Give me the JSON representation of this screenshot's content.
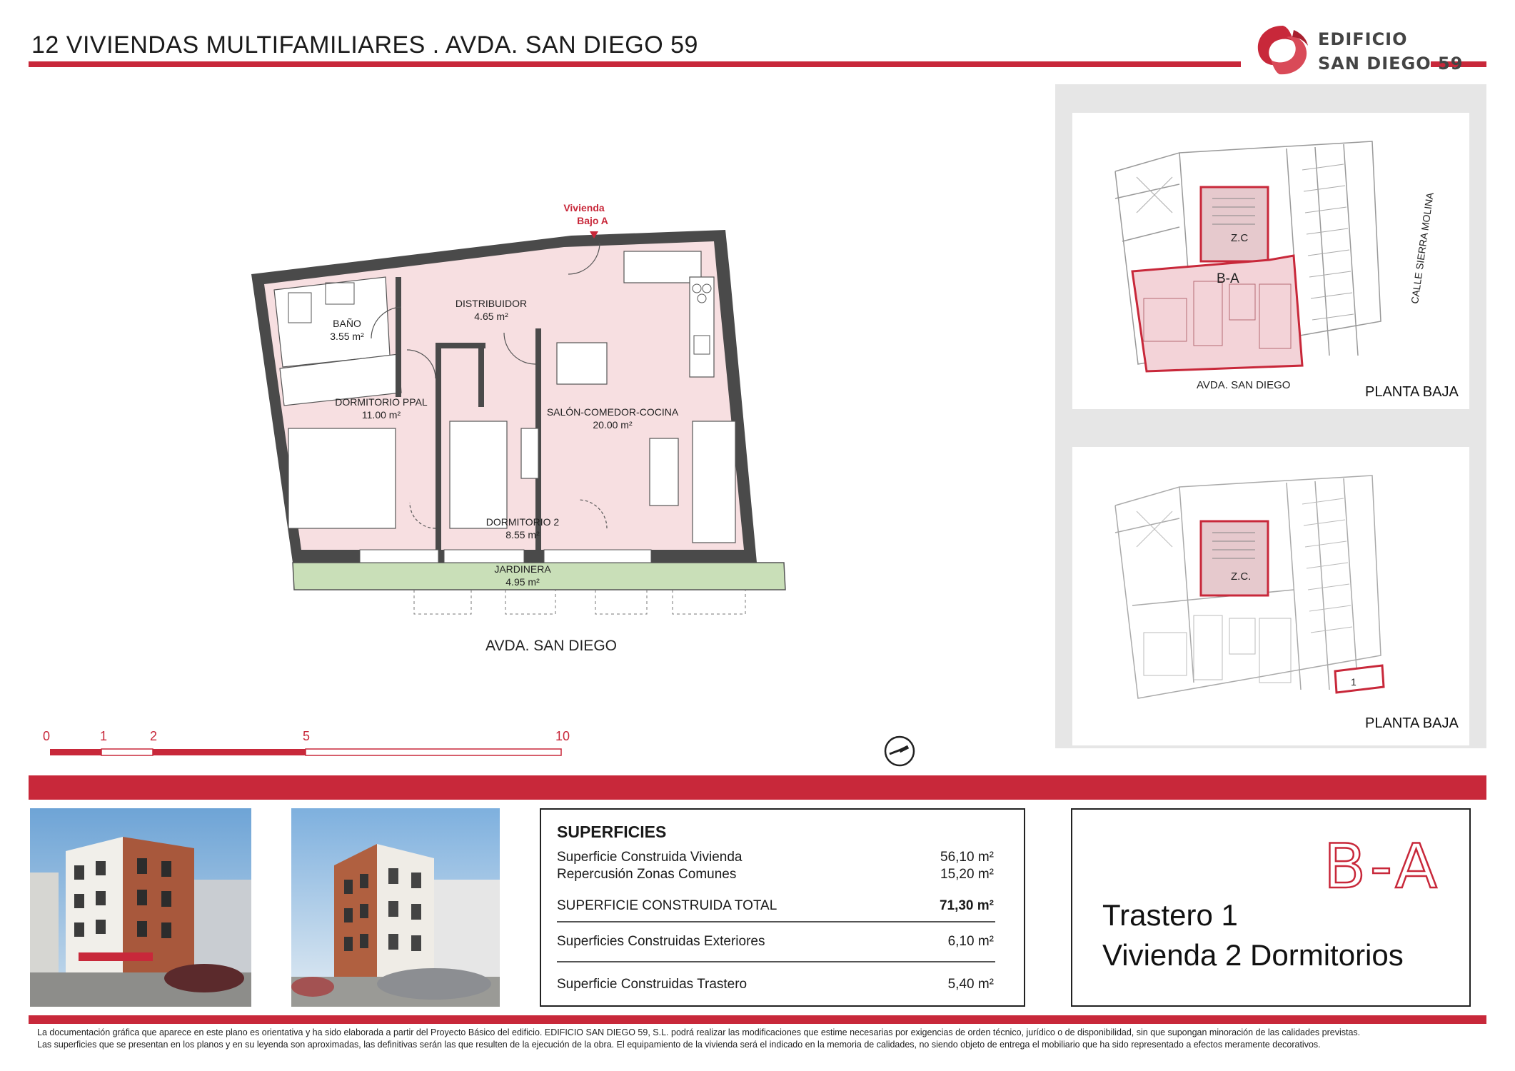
{
  "header": {
    "title": "12 VIVIENDAS MULTIFAMILIARES . AVDA. SAN DIEGO 59",
    "logo_line1": "EDIFICIO",
    "logo_line2": "SAN DIEGO 59",
    "brand_color": "#c8283a"
  },
  "plan": {
    "entry_label_line1": "Vivienda",
    "entry_label_line2": "Bajo A",
    "rooms": [
      {
        "name": "BAÑO",
        "area": "3.55 m²"
      },
      {
        "name": "DISTRIBUIDOR",
        "area": "4.65 m²"
      },
      {
        "name": "DORMITORIO PPAL",
        "area": "11.00 m²"
      },
      {
        "name": "SALÓN-COMEDOR-COCINA",
        "area": "20.00 m²"
      },
      {
        "name": "DORMITORIO 2",
        "area": "8.55 m²"
      },
      {
        "name": "JARDINERA",
        "area": "4.95 m²"
      }
    ],
    "street": "AVDA. SAN DIEGO",
    "room_fill": "#f7dfe1",
    "garden_fill": "#c9dfb8"
  },
  "scale": {
    "ticks": [
      "0",
      "1",
      "2",
      "5",
      "10"
    ]
  },
  "key_plans": {
    "top": {
      "unit_label": "B-A",
      "common_label": "Z.C",
      "street_bottom": "AVDA. SAN DIEGO",
      "street_side": "CALLE SIERRA MOLINA",
      "floor": "PLANTA BAJA"
    },
    "bottom": {
      "common_label": "Z.C.",
      "storage_label": "1",
      "floor": "PLANTA BAJA"
    }
  },
  "areas": {
    "title": "SUPERFICIES",
    "rows": [
      {
        "label": "Superficie Construida Vivienda",
        "value": "56,10 m²"
      },
      {
        "label": "Repercusión Zonas Comunes",
        "value": "15,20 m²"
      },
      {
        "label": "SUPERFICIE CONSTRUIDA TOTAL",
        "value": "71,30  m²"
      },
      {
        "label": "Superficies Construidas Exteriores",
        "value": "6,10 m²"
      },
      {
        "label": "Superficie Construidas Trastero",
        "value": "5,40 m²"
      }
    ]
  },
  "unit": {
    "code": "B-A",
    "line1": "Trastero 1",
    "line2": "Vivienda 2 Dormitorios"
  },
  "disclaimer": {
    "line1": "La documentación gráfica que aparece en este plano es orientativa y ha sido elaborada a partir del Proyecto Básico del edificio. EDIFICIO SAN DIEGO 59, S.L. podrá realizar las modificaciones que estime necesarias por exigencias de orden técnico, jurídico o de disponibilidad, sin que supongan minoración de las calidades previstas.",
    "line2": "Las superficies que se presentan en los planos y en su leyenda son aproximadas, las definitivas serán las que resulten de la ejecución de la obra. El equipamiento de la vivienda será el indicado en la memoria de calidades, no siendo objeto de entrega el mobiliario que ha sido representado a efectos meramente decorativos."
  }
}
